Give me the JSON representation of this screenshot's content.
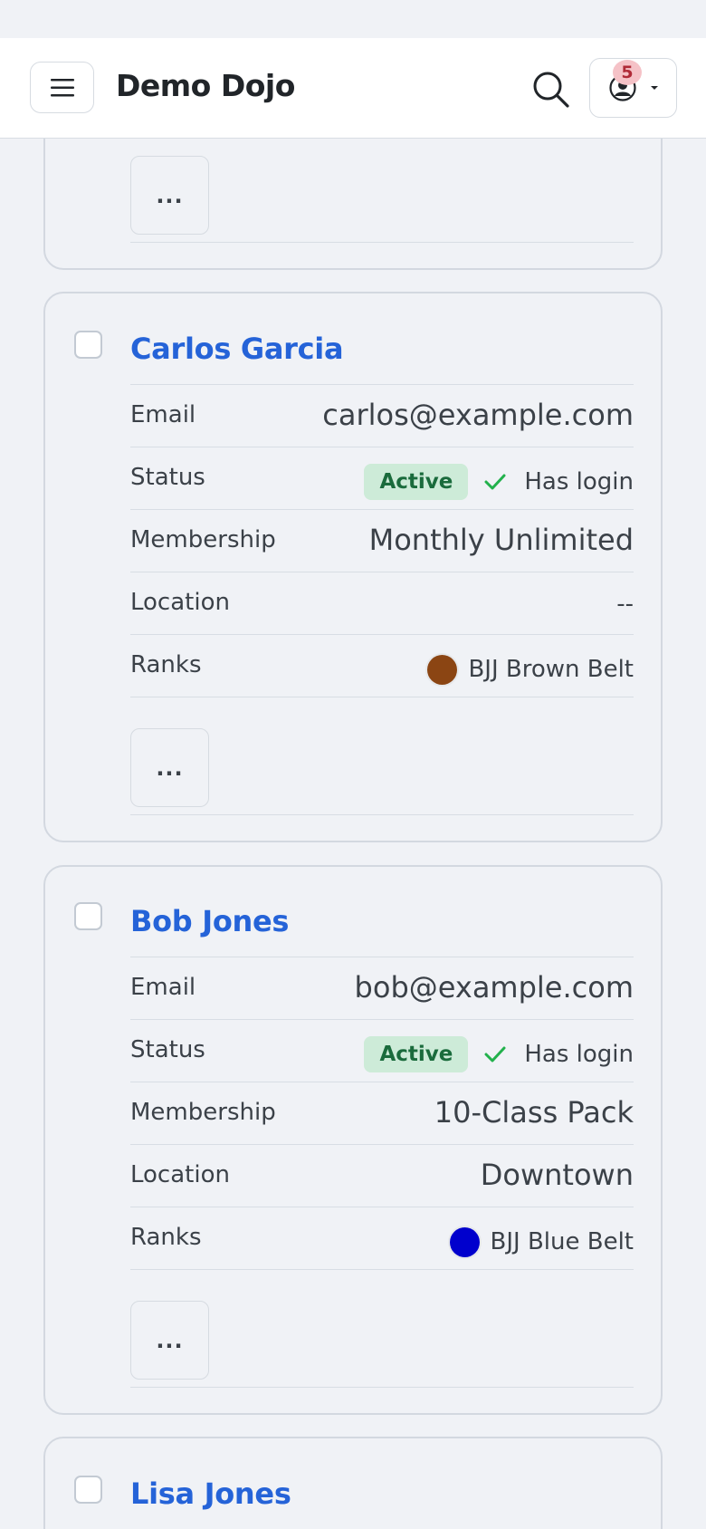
{
  "header": {
    "brand": "Demo Dojo",
    "notification_count": "5"
  },
  "members": [
    {
      "name": "Carlos Garcia",
      "email_label": "Email",
      "email": "carlos@example.com",
      "status_label": "Status",
      "status": "Active",
      "login": "Has login",
      "membership_label": "Membership",
      "membership": "Monthly Unlimited",
      "location_label": "Location",
      "location": "--",
      "ranks_label": "Ranks",
      "rank": "BJJ Brown Belt",
      "rank_color": "#8b4513",
      "more_label": "..."
    },
    {
      "name": "Bob Jones",
      "email_label": "Email",
      "email": "bob@example.com",
      "status_label": "Status",
      "status": "Active",
      "login": "Has login",
      "membership_label": "Membership",
      "membership": "10-Class Pack",
      "location_label": "Location",
      "location": "Downtown",
      "ranks_label": "Ranks",
      "rank": "BJJ Blue Belt",
      "rank_color": "#0000cd",
      "more_label": "..."
    },
    {
      "name": "Lisa Jones"
    }
  ],
  "previous_card": {
    "more_label": "..."
  },
  "colors": {
    "link": "#2563d8",
    "active_bg": "#cdebd8",
    "active_text": "#1a6b3c",
    "check": "#22b14c",
    "notif_bg": "#f5c2c7"
  }
}
